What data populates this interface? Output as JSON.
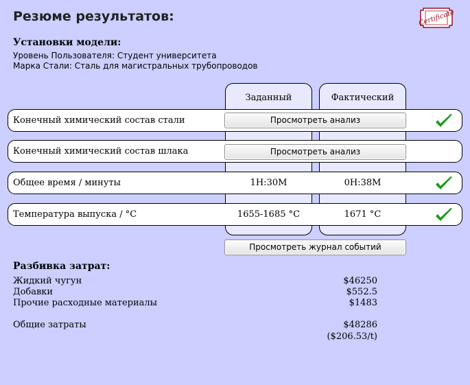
{
  "title": "Резюме результатов:",
  "certificate": {
    "text": "Certificate",
    "color": "#a01020"
  },
  "model_settings": {
    "heading": "Установки модели:",
    "lines": [
      "Уровень Пользователя: Студент университета",
      "Марка Стали: Сталь для магистральных трубопроводов"
    ]
  },
  "columns": {
    "target": "Заданный",
    "actual": "Фактический"
  },
  "rows": [
    {
      "label": "Конечный химический состав стали",
      "button": "Просмотреть анализ",
      "check": true
    },
    {
      "label": "Конечный химический состав шлака",
      "button": "Просмотреть анализ",
      "check": false
    },
    {
      "label": "Общее время / минуты",
      "target": "1H:30M",
      "actual": "0H:38M",
      "check": true
    },
    {
      "label": "Температура выпуска / °C",
      "target": "1655-1685 °C",
      "actual": "1671 °C",
      "check": true
    }
  ],
  "log_button": "Просмотреть журнал событий",
  "costs": {
    "heading": "Разбивка затрат:",
    "items": [
      {
        "label": "Жидкий чугун",
        "value": "$46250"
      },
      {
        "label": "Добавки",
        "value": "$552.5"
      },
      {
        "label": "Прочие расходные материалы",
        "value": "$1483"
      }
    ],
    "total_label": "Общие затраты",
    "total_value": "$48286",
    "per_ton": "($206.53/t)"
  },
  "colors": {
    "background": "#cccfff",
    "column_bg": "#e8e8ff",
    "check": "#1a9a1a"
  }
}
